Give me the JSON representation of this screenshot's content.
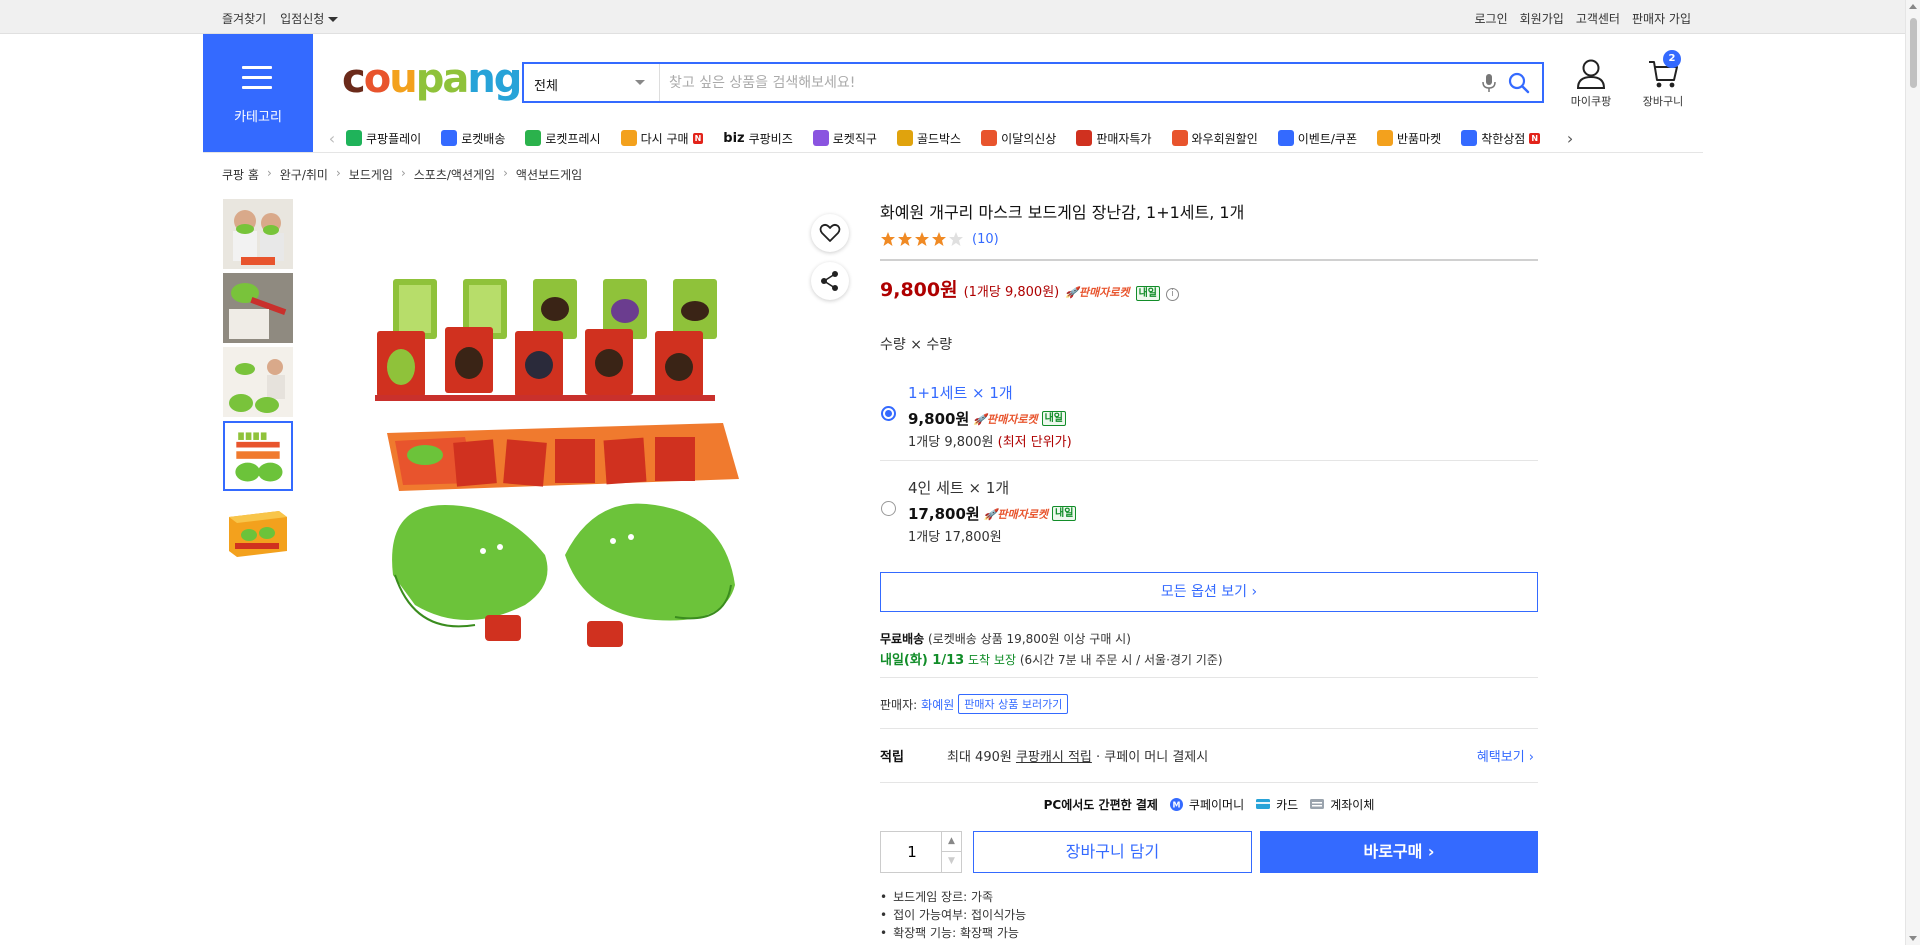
{
  "topbar": {
    "favorites": "즐겨찾기",
    "partner": "입점신청",
    "login": "로그인",
    "signup": "회원가입",
    "support": "고객센터",
    "seller_signup": "판매자 가입"
  },
  "header": {
    "category_label": "카테고리",
    "logo_parts": [
      "c",
      "o",
      "u",
      "pa",
      "ng"
    ],
    "search": {
      "scope": "전체",
      "placeholder": "찾고 싶은 상품을 검색해보세요!"
    },
    "my_coupang": "마이쿠팡",
    "cart_label": "장바구니",
    "cart_count": "2"
  },
  "quick_menu": [
    {
      "label": "쿠팡플레이",
      "icon": "play-icon",
      "color": "#1fb35a"
    },
    {
      "label": "로켓배송",
      "icon": "rocket-icon",
      "color": "#346aff"
    },
    {
      "label": "로켓프레시",
      "icon": "rocket-fresh-icon",
      "color": "#2bb24c"
    },
    {
      "label": "다시 구매",
      "icon": "rebuy-icon",
      "color": "#f3a11d",
      "badge": "N"
    },
    {
      "label": "쿠팡비즈",
      "icon": "biz-icon",
      "color": "#111111",
      "prefix": "biz"
    },
    {
      "label": "로켓직구",
      "icon": "global-icon",
      "color": "#8a54e0"
    },
    {
      "label": "골드박스",
      "icon": "goldbox-icon",
      "color": "#e0a30d"
    },
    {
      "label": "이달의신상",
      "icon": "new-icon",
      "color": "#e8542d"
    },
    {
      "label": "판매자특가",
      "icon": "sale-icon",
      "color": "#d0311f"
    },
    {
      "label": "와우회원할인",
      "icon": "wow-icon",
      "color": "#e8542d"
    },
    {
      "label": "이벤트/쿠폰",
      "icon": "coupon-icon",
      "color": "#346aff"
    },
    {
      "label": "반품마켓",
      "icon": "return-icon",
      "color": "#f3a11d"
    },
    {
      "label": "착한상점",
      "icon": "goodshop-icon",
      "color": "#346aff",
      "badge": "N"
    }
  ],
  "breadcrumb": [
    "쿠팡 홈",
    "완구/취미",
    "보드게임",
    "스포츠/액션게임",
    "액션보드게임"
  ],
  "product": {
    "title": "화예원 개구리 마스크 보드게임 장난감, 1+1세트, 1개",
    "rating": 4,
    "review_count": "(10)",
    "price": "9,800원",
    "unit_price": "(1개당 9,800원)",
    "rocket_label": "판매자로켓",
    "tomorrow": "내일",
    "quantity_label": "수량 × 수량",
    "options": [
      {
        "name": "1+1세트 × 1개",
        "price": "9,800원",
        "rocket": "판매자로켓",
        "tomorrow": "내일",
        "unit": "1개당 9,800원",
        "note": "(최저 단위가)",
        "selected": true
      },
      {
        "name": "4인 세트 × 1개",
        "price": "17,800원",
        "rocket": "판매자로켓",
        "tomorrow": "내일",
        "unit": "1개당 17,800원",
        "note": "",
        "selected": false
      }
    ],
    "all_options": "모든 옵션 보기 ›",
    "shipping_title": "무료배송",
    "shipping_cond": "(로켓배송 상품 19,800원 이상 구매 시)",
    "arrival": "내일(화) 1/13",
    "arrival_tail": "도착 보장",
    "arrival_note": "(6시간 7분 내 주문 시 / 서울·경기 기준)",
    "seller_label": "판매자:",
    "seller_name": "화예원",
    "seller_link": "판매자 상품 보러가기",
    "reward_title": "적립",
    "reward_prefix": "최대 490원",
    "reward_link": "쿠팡캐시 적립",
    "reward_suffix": "· 쿠페이 머니 결제시",
    "reward_more": "혜택보기 ›",
    "pay_title": "PC에서도 간편한 결제",
    "pay_methods": [
      "쿠페이머니",
      "카드",
      "계좌이체"
    ],
    "quantity": "1",
    "add_to_cart": "장바구니 담기",
    "buy_now": "바로구매 ›",
    "specs": [
      "보드게임 장르: 가족",
      "접이 가능여부: 접이식가능",
      "확장팩 기능: 확장팩 가능"
    ]
  }
}
